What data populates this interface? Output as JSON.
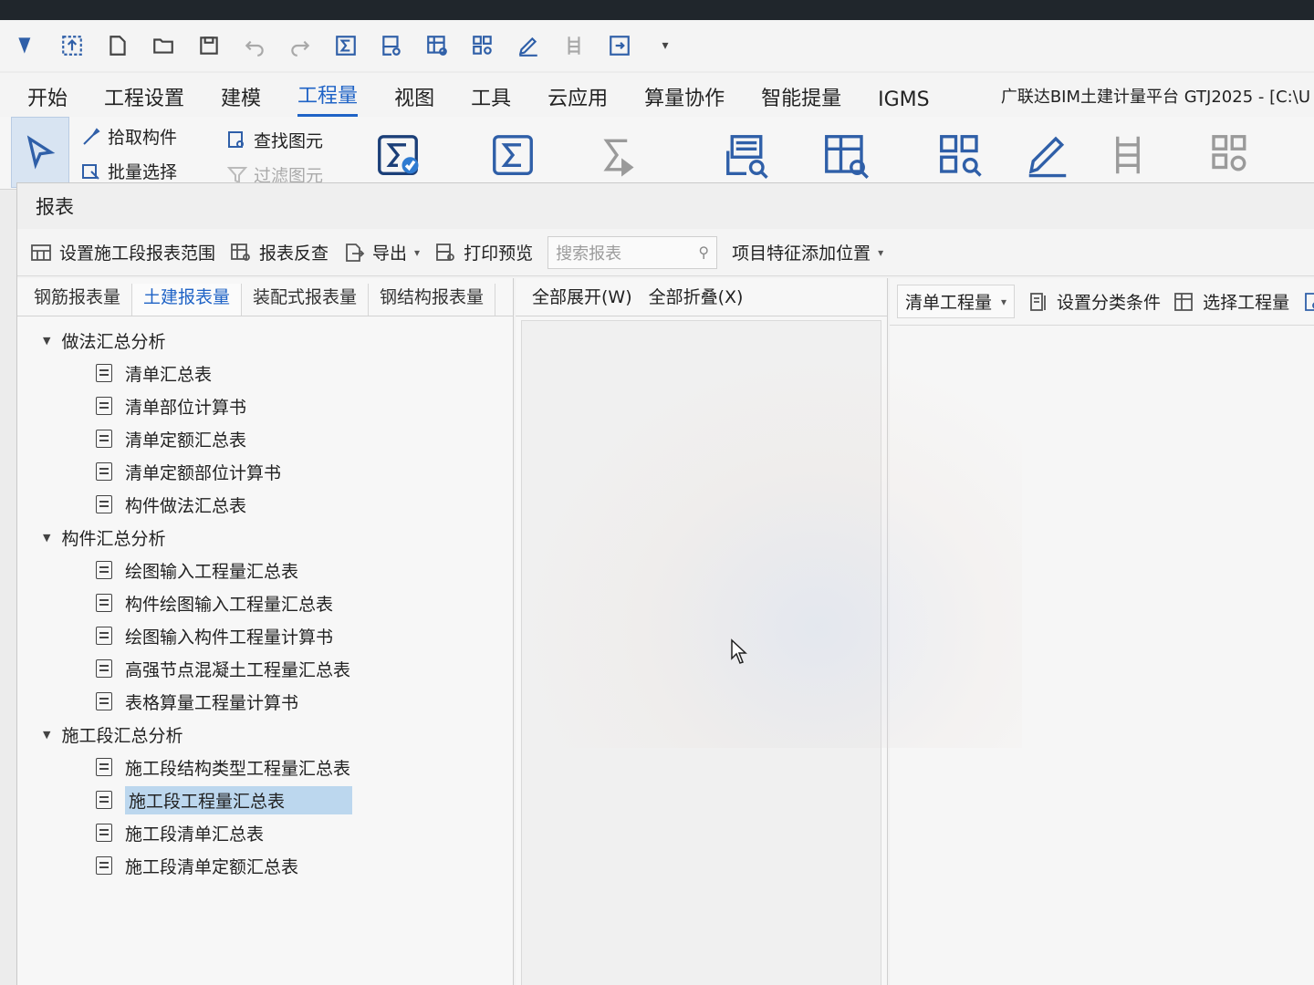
{
  "app_title": "广联达BIM土建计量平台 GTJ2025 - [C:\\U",
  "menu_tabs": [
    "开始",
    "工程设置",
    "建模",
    "工程量",
    "视图",
    "工具",
    "云应用",
    "算量协作",
    "智能提量",
    "IGMS"
  ],
  "active_menu_tab": "工程量",
  "ribbon": {
    "pick_component": "拾取构件",
    "batch_select": "批量选择",
    "find_element": "查找图元",
    "filter_element": "过滤图元"
  },
  "report": {
    "window_title": "报表",
    "toolbar": {
      "set_stage_range": "设置施工段报表范围",
      "report_review": "报表反查",
      "export": "导出",
      "print_preview": "打印预览",
      "search_placeholder": "搜索报表",
      "add_feature_position": "项目特征添加位置"
    },
    "subtabs": [
      "钢筋报表量",
      "土建报表量",
      "装配式报表量",
      "钢结构报表量"
    ],
    "active_subtab": "土建报表量",
    "tree": [
      {
        "group": "做法汇总分析",
        "items": [
          "清单汇总表",
          "清单部位计算书",
          "清单定额汇总表",
          "清单定额部位计算书",
          "构件做法汇总表"
        ]
      },
      {
        "group": "构件汇总分析",
        "items": [
          "绘图输入工程量汇总表",
          "构件绘图输入工程量汇总表",
          "绘图输入构件工程量计算书",
          "高强节点混凝土工程量汇总表",
          "表格算量工程量计算书"
        ]
      },
      {
        "group": "施工段汇总分析",
        "items": [
          "施工段结构类型工程量汇总表",
          "施工段工程量汇总表",
          "施工段清单汇总表",
          "施工段清单定额汇总表"
        ]
      }
    ],
    "selected_item": "施工段工程量汇总表",
    "middle": {
      "expand_all": "全部展开(W)",
      "collapse_all": "全部折叠(X)"
    },
    "right": {
      "quantity_dropdown": "清单工程量",
      "set_category": "设置分类条件",
      "select_quantity": "选择工程量",
      "settings_partial": "设"
    }
  },
  "colors": {
    "accent": "#1f63c6",
    "selection": "#bcd7ee",
    "icon_blue": "#2f5fa8"
  }
}
